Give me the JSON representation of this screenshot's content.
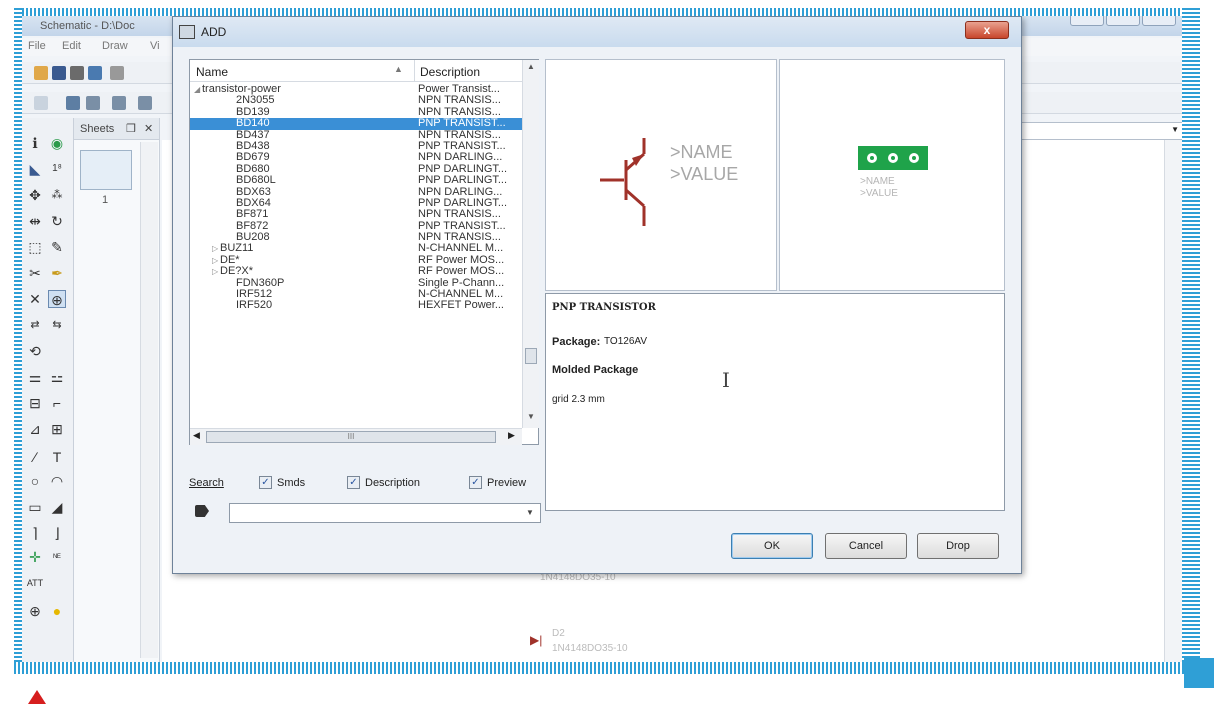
{
  "main_window": {
    "title": "Schematic - D:\\Doc",
    "menu": [
      "File",
      "Edit",
      "Draw",
      "Vi"
    ],
    "sheets_label": "Sheets",
    "sheets_pin": "❒",
    "sheets_close": "✕",
    "sheet_number": "1",
    "canvas_parts": [
      {
        "label": "1N4148DO35-10"
      },
      {
        "label": "D2"
      },
      {
        "label": "1N4148DO35-10"
      }
    ]
  },
  "dialog": {
    "title": "ADD",
    "close_label": "x",
    "list": {
      "columns": [
        "Name",
        "Description"
      ],
      "rows": [
        {
          "name": "transistor-power",
          "desc": "Power Transist...",
          "level": "parent",
          "expanded": true
        },
        {
          "name": "2N3055",
          "desc": "NPN TRANSIS...",
          "level": "leaf"
        },
        {
          "name": "BD139",
          "desc": "NPN TRANSIS...",
          "level": "leaf"
        },
        {
          "name": "BD140",
          "desc": "PNP TRANSIST...",
          "level": "leaf",
          "selected": true
        },
        {
          "name": "BD437",
          "desc": "NPN TRANSIS...",
          "level": "leaf"
        },
        {
          "name": "BD438",
          "desc": "PNP TRANSIST...",
          "level": "leaf"
        },
        {
          "name": "BD679",
          "desc": "NPN DARLING...",
          "level": "leaf"
        },
        {
          "name": "BD680",
          "desc": "PNP DARLINGT...",
          "level": "leaf"
        },
        {
          "name": "BD680L",
          "desc": "PNP DARLINGT...",
          "level": "leaf"
        },
        {
          "name": "BDX63",
          "desc": "NPN DARLING...",
          "level": "leaf"
        },
        {
          "name": "BDX64",
          "desc": "PNP DARLINGT...",
          "level": "leaf"
        },
        {
          "name": "BF871",
          "desc": "NPN TRANSIS...",
          "level": "leaf"
        },
        {
          "name": "BF872",
          "desc": "PNP TRANSIST...",
          "level": "leaf"
        },
        {
          "name": "BU208",
          "desc": "NPN TRANSIS...",
          "level": "leaf"
        },
        {
          "name": "BUZ11",
          "desc": "N-CHANNEL M...",
          "level": "child"
        },
        {
          "name": "DE*",
          "desc": "RF Power MOS...",
          "level": "child"
        },
        {
          "name": "DE?X*",
          "desc": "RF Power MOS...",
          "level": "child"
        },
        {
          "name": "FDN360P",
          "desc": "Single P-Chann...",
          "level": "leaf"
        },
        {
          "name": "IRF512",
          "desc": "N-CHANNEL M...",
          "level": "leaf"
        },
        {
          "name": "IRF520",
          "desc": "HEXFET Power...",
          "level": "leaf"
        }
      ],
      "hscroll_label": "III"
    },
    "search": {
      "label": "Search",
      "options": [
        {
          "label": "Smds",
          "checked": true
        },
        {
          "label": "Description",
          "checked": true
        },
        {
          "label": "Preview",
          "checked": true
        }
      ],
      "value": "",
      "placeholder": ""
    },
    "preview": {
      "symbol_name": ">NAME",
      "symbol_value": ">VALUE",
      "package_name": ">NAME",
      "package_value": ">VALUE",
      "symbol_color": "#a0322a",
      "package_color": "#1fa34a"
    },
    "description": {
      "title": "PNP TRANSISTOR",
      "package_label": "Package:",
      "package_value": "TO126AV",
      "molded": "Molded Package",
      "grid": "grid 2.3 mm"
    },
    "buttons": {
      "ok": "OK",
      "cancel": "Cancel",
      "drop": "Drop"
    }
  },
  "colors": {
    "frame_accent": "#2f9fd6",
    "selection": "#3a8fd6",
    "marker": "#d61e1e"
  }
}
